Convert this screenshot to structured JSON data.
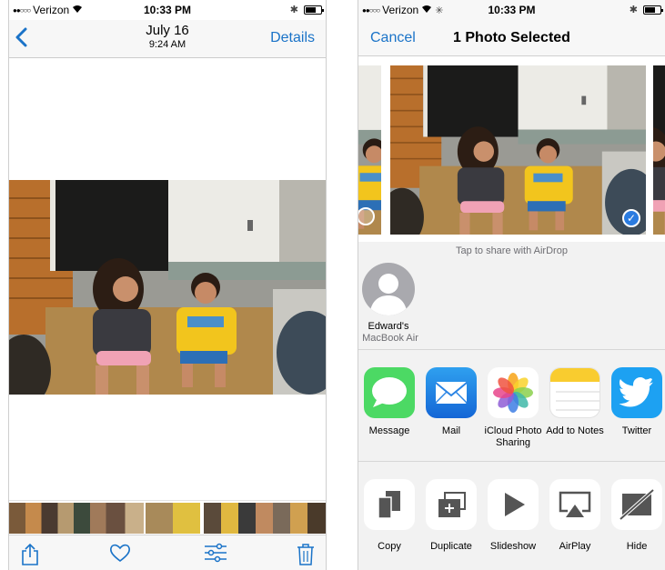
{
  "left_screen": {
    "status": {
      "carrier": "Verizon",
      "time": "10:33 PM",
      "signal": "●●○○○"
    },
    "nav": {
      "date": "July 16",
      "time": "9:24 AM",
      "details_label": "Details"
    },
    "toolbar": {
      "icons": [
        "share-icon",
        "heart-icon",
        "adjust-icon",
        "trash-icon"
      ]
    }
  },
  "right_screen": {
    "status": {
      "carrier": "Verizon",
      "time": "10:33 PM",
      "signal": "●●○○○"
    },
    "nav": {
      "cancel_label": "Cancel",
      "title": "1 Photo Selected"
    },
    "airdrop_hint": "Tap to share with AirDrop",
    "contact": {
      "name": "Edward's",
      "device": "MacBook Air"
    },
    "share_apps": [
      {
        "label": "Message",
        "icon": "message-icon",
        "color": "#4cd964"
      },
      {
        "label": "Mail",
        "icon": "mail-icon",
        "color": "#1e88e5"
      },
      {
        "label": "iCloud Photo Sharing",
        "icon": "icloud-photos-icon",
        "color": "#ffffff"
      },
      {
        "label": "Add to Notes",
        "icon": "notes-icon",
        "color": "#ffffff"
      },
      {
        "label": "Twitter",
        "icon": "twitter-icon",
        "color": "#1da1f2"
      }
    ],
    "actions": [
      {
        "label": "Copy",
        "icon": "copy-icon"
      },
      {
        "label": "Duplicate",
        "icon": "duplicate-icon"
      },
      {
        "label": "Slideshow",
        "icon": "slideshow-icon"
      },
      {
        "label": "AirPlay",
        "icon": "airplay-icon"
      },
      {
        "label": "Hide",
        "icon": "hide-icon"
      }
    ]
  },
  "colors": {
    "accent": "#1a73c8",
    "selected_badge": "#2a7be0"
  }
}
